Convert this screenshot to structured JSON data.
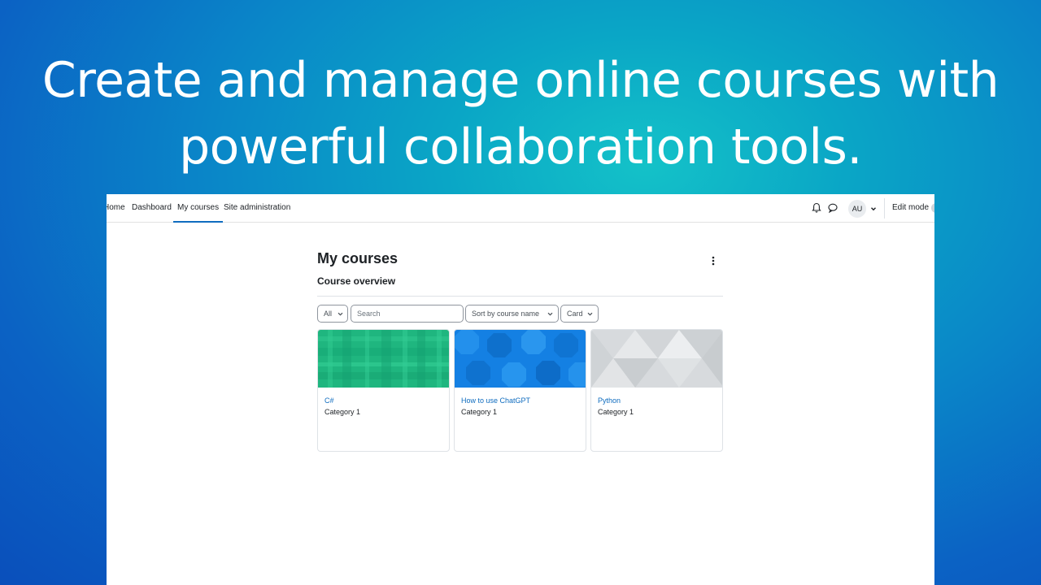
{
  "headline": {
    "line1": "Create and manage online courses with",
    "line2": "powerful collaboration tools."
  },
  "navbar": {
    "links": [
      "Home",
      "Dashboard",
      "My courses",
      "Site administration"
    ],
    "active": "My courses",
    "avatar_initials": "AU",
    "edit_mode_label": "Edit mode"
  },
  "page": {
    "title": "My courses",
    "section_title": "Course overview"
  },
  "filters": {
    "grouping": "All",
    "search_placeholder": "Search",
    "sort": "Sort by course name",
    "view": "Card"
  },
  "courses": [
    {
      "name": "C#",
      "category": "Category 1",
      "image": "green-plaid-pattern"
    },
    {
      "name": "How to use ChatGPT",
      "category": "Category 1",
      "image": "blue-octagon-pattern"
    },
    {
      "name": "Python",
      "category": "Category 1",
      "image": "grey-triangle-pattern"
    }
  ],
  "colors": {
    "background": "#0a86c8",
    "link": "#0f6cbf",
    "active_tab": "#0f6cbf",
    "text": "#1d2125",
    "card_green": "#1fb67f",
    "card_blue": "#1480e3",
    "card_grey": "#d7dadd"
  }
}
